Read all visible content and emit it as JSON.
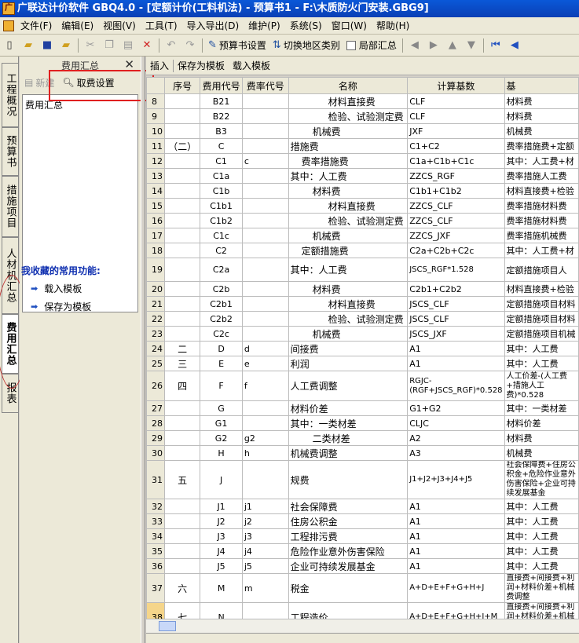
{
  "window": {
    "title": "广联达计价软件 GBQ4.0 - [定额计价(工料机法) - 预算书1 - F:\\木质防火门安装.GBG9]"
  },
  "menu": [
    "文件(F)",
    "编辑(E)",
    "视图(V)",
    "工具(T)",
    "导入导出(D)",
    "维护(P)",
    "系统(S)",
    "窗口(W)",
    "帮助(H)"
  ],
  "toolbar": {
    "budget_settings": "预算书设置",
    "switch_region": "切换地区类别",
    "local_summary": "局部汇总"
  },
  "vtabs": [
    "工程概况",
    "预算书",
    "措施项目",
    "人材机汇总",
    "费用汇总",
    "报表"
  ],
  "left_panel": {
    "title": "费用汇总",
    "new_label": "新建",
    "fee_setting": "取费设置",
    "tree_item": "费用汇总",
    "fav_title": "我收藏的常用功能:",
    "fav_items": [
      "载入模板",
      "保存为模板"
    ]
  },
  "right_toolbar": [
    "插入",
    "保存为模板",
    "载入模板"
  ],
  "table": {
    "headers": [
      "",
      "序号",
      "费用代号",
      "费率代号",
      "名称",
      "计算基数",
      "基"
    ],
    "rows": [
      [
        "8",
        "",
        "B21",
        "",
        "材料直接费",
        "CLF",
        "材料费"
      ],
      [
        "9",
        "",
        "B22",
        "",
        "检验、试验测定费",
        "CLF",
        "材料费"
      ],
      [
        "10",
        "",
        "B3",
        "",
        "机械费",
        "JXF",
        "机械费"
      ],
      [
        "11",
        "（二）",
        "C",
        "",
        "措施费",
        "C1+C2",
        "费率措施费+定额"
      ],
      [
        "12",
        "",
        "C1",
        "c",
        "费率措施费",
        "C1a+C1b+C1c",
        "其中：人工费+材"
      ],
      [
        "13",
        "",
        "C1a",
        "",
        "其中：人工费",
        "ZZCS_RGF",
        "费率措施人工费"
      ],
      [
        "14",
        "",
        "C1b",
        "",
        "材料费",
        "C1b1+C1b2",
        "材料直接费+检验"
      ],
      [
        "15",
        "",
        "C1b1",
        "",
        "材料直接费",
        "ZZCS_CLF",
        "费率措施材料费"
      ],
      [
        "16",
        "",
        "C1b2",
        "",
        "检验、试验测定费",
        "ZZCS_CLF",
        "费率措施材料费"
      ],
      [
        "17",
        "",
        "C1c",
        "",
        "机械费",
        "ZZCS_JXF",
        "费率措施机械费"
      ],
      [
        "18",
        "",
        "C2",
        "",
        "定额措施费",
        "C2a+C2b+C2c",
        "其中：人工费+材"
      ],
      [
        "19",
        "",
        "C2a",
        "",
        "其中：人工费",
        "JSCS_RGF*1.528",
        "定额措施项目人"
      ],
      [
        "20",
        "",
        "C2b",
        "",
        "材料费",
        "C2b1+C2b2",
        "材料直接费+检验"
      ],
      [
        "21",
        "",
        "C2b1",
        "",
        "材料直接费",
        "JSCS_CLF",
        "定额措施项目材料"
      ],
      [
        "22",
        "",
        "C2b2",
        "",
        "检验、试验测定费",
        "JSCS_CLF",
        "定额措施项目材料"
      ],
      [
        "23",
        "",
        "C2c",
        "",
        "机械费",
        "JSCS_JXF",
        "定额措施项目机械"
      ],
      [
        "24",
        "二",
        "D",
        "d",
        "间接费",
        "A1",
        "其中：人工费"
      ],
      [
        "25",
        "三",
        "E",
        "e",
        "利润",
        "A1",
        "其中：人工费"
      ],
      [
        "26",
        "四",
        "F",
        "f",
        "人工费调整",
        "RGJC-(RGF+JSCS_RGF)*0.528",
        "人工价差-(人工费+措施人工费)*0.528"
      ],
      [
        "27",
        "",
        "G",
        "",
        "材料价差",
        "G1+G2",
        "其中：一类材差"
      ],
      [
        "28",
        "",
        "G1",
        "",
        "其中：一类材差",
        "CLJC",
        "材料价差"
      ],
      [
        "29",
        "",
        "G2",
        "g2",
        "二类材差",
        "A2",
        "材料费"
      ],
      [
        "30",
        "",
        "H",
        "h",
        "机械费调整",
        "A3",
        "机械费"
      ],
      [
        "31",
        "五",
        "J",
        "",
        "规费",
        "J1+J2+J3+J4+J5",
        "社会保障费+住房公积金+危险作业意外伤害保险+企业可持续发展基金"
      ],
      [
        "32",
        "",
        "J1",
        "j1",
        "社会保障费",
        "A1",
        "其中：人工费"
      ],
      [
        "33",
        "",
        "J2",
        "j2",
        "住房公积金",
        "A1",
        "其中：人工费"
      ],
      [
        "34",
        "",
        "J3",
        "j3",
        "工程排污费",
        "A1",
        "其中：人工费"
      ],
      [
        "35",
        "",
        "J4",
        "j4",
        "危险作业意外伤害保险",
        "A1",
        "其中：人工费"
      ],
      [
        "36",
        "",
        "J5",
        "j5",
        "企业可持续发展基金",
        "A1",
        "其中：人工费"
      ],
      [
        "37",
        "六",
        "M",
        "m",
        "税金",
        "A+D+E+F+G+H+J",
        "直接费+间接费+利润+材料价差+机械费调整"
      ],
      [
        "38",
        "七",
        "N",
        "",
        "工程造价",
        "A+D+E+F+G+H+J+M",
        "直接费+间接费+利润+材料价差+机械费调整"
      ]
    ]
  }
}
